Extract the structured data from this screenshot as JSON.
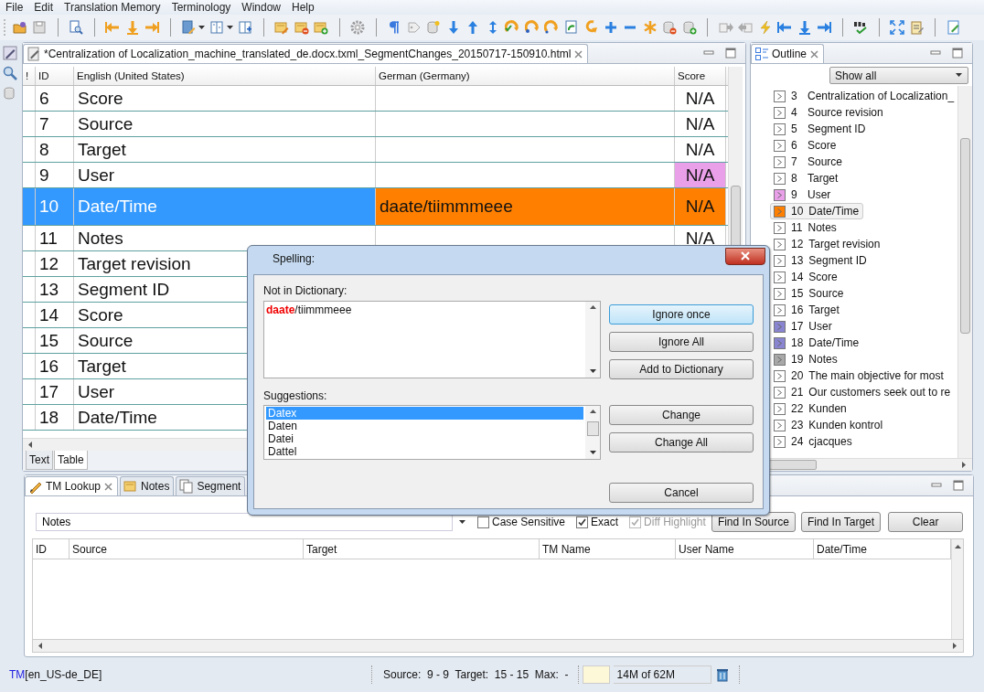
{
  "menu": [
    "File",
    "Edit",
    "Translation Memory",
    "Terminology",
    "Window",
    "Help"
  ],
  "editor": {
    "tab_title": "*Centralization of Localization_machine_translated_de.docx.txml_SegmentChanges_20150717-150910.html",
    "columns": [
      "!",
      "ID",
      "English (United States)",
      "German (Germany)",
      "Score"
    ],
    "rows": [
      {
        "id": "6",
        "source": "Score",
        "score": "N/A",
        "selected": false
      },
      {
        "id": "7",
        "source": "Source",
        "score": "N/A",
        "selected": false
      },
      {
        "id": "8",
        "source": "Target",
        "score": "N/A",
        "selected": false
      },
      {
        "id": "9",
        "source": "User",
        "score": "N/A",
        "color": "#e9a0e9",
        "selected": false
      },
      {
        "id": "10",
        "source": "Date/Time",
        "target": "daate/tiimmmeee",
        "score": "N/A",
        "color": "#ff8000",
        "selected": true
      },
      {
        "id": "11",
        "source": "Notes",
        "score": "N/A",
        "selected": false
      },
      {
        "id": "12",
        "source": "Target revision",
        "selected": false
      },
      {
        "id": "13",
        "source": "Segment ID",
        "selected": false
      },
      {
        "id": "14",
        "source": "Score",
        "selected": false
      },
      {
        "id": "15",
        "source": "Source",
        "selected": false
      },
      {
        "id": "16",
        "source": "Target",
        "selected": false
      },
      {
        "id": "17",
        "source": "User",
        "selected": false
      },
      {
        "id": "18",
        "source": "Date/Time",
        "selected": false
      }
    ],
    "view_tabs": [
      {
        "label": "Text",
        "selected": false
      },
      {
        "label": "Table",
        "selected": true
      }
    ]
  },
  "outline": {
    "title": "Outline",
    "filter": "Show all",
    "items": [
      {
        "id": "3",
        "text": "Centralization of Localization_",
        "color": "#ffffff",
        "selected": false
      },
      {
        "id": "4",
        "text": "Source revision",
        "color": "#ffffff",
        "selected": false
      },
      {
        "id": "5",
        "text": "Segment ID",
        "color": "#ffffff",
        "selected": false
      },
      {
        "id": "6",
        "text": "Score",
        "color": "#ffffff",
        "selected": false
      },
      {
        "id": "7",
        "text": "Source",
        "color": "#ffffff",
        "selected": false
      },
      {
        "id": "8",
        "text": "Target",
        "color": "#ffffff",
        "selected": false
      },
      {
        "id": "9",
        "text": "User",
        "color": "#e9a0e9",
        "selected": false
      },
      {
        "id": "10",
        "text": "Date/Time",
        "color": "#ff8000",
        "selected": true
      },
      {
        "id": "11",
        "text": "Notes",
        "color": "#ffffff",
        "selected": false
      },
      {
        "id": "12",
        "text": "Target revision",
        "color": "#ffffff",
        "selected": false
      },
      {
        "id": "13",
        "text": "Segment ID",
        "color": "#ffffff",
        "selected": false
      },
      {
        "id": "14",
        "text": "Score",
        "color": "#ffffff",
        "selected": false
      },
      {
        "id": "15",
        "text": "Source",
        "color": "#ffffff",
        "selected": false
      },
      {
        "id": "16",
        "text": "Target",
        "color": "#ffffff",
        "selected": false
      },
      {
        "id": "17",
        "text": "User",
        "color": "#8a85d0",
        "selected": false
      },
      {
        "id": "18",
        "text": "Date/Time",
        "color": "#8a85d0",
        "selected": false
      },
      {
        "id": "19",
        "text": "Notes",
        "color": "#a8a8a8",
        "selected": false
      },
      {
        "id": "20",
        "text": "The main objective for most",
        "color": "#ffffff",
        "selected": false
      },
      {
        "id": "21",
        "text": "Our customers seek out to re",
        "color": "#ffffff",
        "selected": false
      },
      {
        "id": "22",
        "text": "Kunden",
        "color": "#ffffff",
        "selected": false
      },
      {
        "id": "23",
        "text": "Kunden kontrol",
        "color": "#ffffff",
        "selected": false
      },
      {
        "id": "24",
        "text": "cjacques",
        "color": "#ffffff",
        "selected": false
      }
    ]
  },
  "lookup": {
    "tabs": [
      {
        "label": "TM Lookup",
        "selected": true
      },
      {
        "label": "Notes",
        "selected": false
      },
      {
        "label": "Segment",
        "selected": false
      }
    ],
    "query": "Notes",
    "options": [
      {
        "label": "Case Sensitive",
        "checked": false,
        "disabled": false
      },
      {
        "label": "Exact",
        "checked": true,
        "disabled": false
      },
      {
        "label": "Diff Highlight",
        "checked": true,
        "disabled": true
      }
    ],
    "buttons": [
      "Find In Source",
      "Find In Target",
      "Clear"
    ],
    "columns": [
      "ID",
      "Source",
      "Target",
      "TM Name",
      "User Name",
      "Date/Time"
    ]
  },
  "status_bar": {
    "tm": "TM",
    "locale": "[en_US-de_DE]",
    "counts": "Source:  9 - 9  Target:  15 - 15  Max:  -",
    "memory": "14M of 62M"
  },
  "dialog": {
    "title": "Spelling:",
    "not_in_dictionary_label": "Not in Dictionary:",
    "text": "**daate**/tiimmmeee",
    "suggestions_label": "Suggestions:",
    "suggestions": [
      {
        "text": "Datex",
        "selected": true
      },
      {
        "text": "Daten",
        "selected": false
      },
      {
        "text": "Datei",
        "selected": false
      },
      {
        "text": "Dattel",
        "selected": false
      }
    ],
    "buttons": [
      {
        "label": "Ignore once",
        "default": true
      },
      {
        "label": "Ignore All",
        "default": false
      },
      {
        "label": "Add to Dictionary",
        "default": false
      },
      {
        "label": "Change",
        "default": false
      },
      {
        "label": "Change All",
        "default": false
      },
      {
        "label": "Cancel",
        "default": false
      }
    ]
  }
}
